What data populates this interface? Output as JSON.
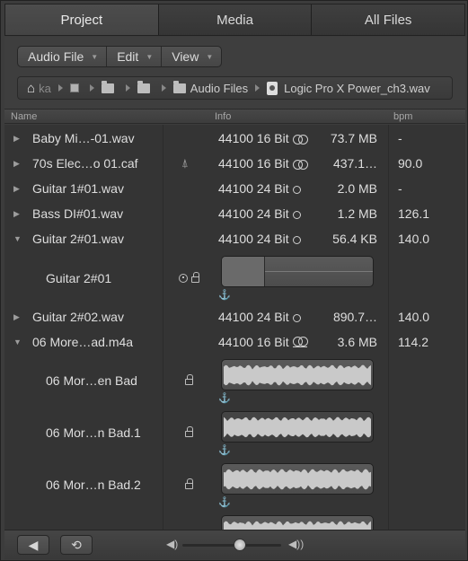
{
  "tabs": [
    "Project",
    "Media",
    "All Files"
  ],
  "toolbar": {
    "menus": [
      "Audio File",
      "Edit",
      "View"
    ]
  },
  "path": {
    "home": "ka",
    "folder": "Audio Files",
    "file": "Logic Pro X Power_ch3.wav"
  },
  "columns": {
    "name": "Name",
    "info": "Info",
    "bpm": "bpm"
  },
  "rows": [
    {
      "name": "Baby Mi…-01.wav",
      "info": "44100 16 Bit",
      "channel": "stereo",
      "size": "73.7 MB",
      "bpm": "-"
    },
    {
      "name": "70s Elec…o 01.caf",
      "info": "44100 16 Bit",
      "channel": "stereo-split",
      "size": "437.1…",
      "bpm": "90.0"
    },
    {
      "name": "Guitar 1#01.wav",
      "info": "44100 24 Bit",
      "channel": "mono",
      "size": "2.0 MB",
      "bpm": "-"
    },
    {
      "name": "Bass DI#01.wav",
      "info": "44100 24 Bit",
      "channel": "mono",
      "size": "1.2 MB",
      "bpm": "126.1"
    },
    {
      "name": "Guitar 2#01.wav",
      "info": "44100 24 Bit",
      "channel": "mono",
      "size": "56.4 KB",
      "bpm": "140.0"
    },
    {
      "name": "Guitar 2#01"
    },
    {
      "name": "Guitar 2#02.wav",
      "info": "44100 24 Bit",
      "channel": "mono",
      "size": "890.7…",
      "bpm": "140.0"
    },
    {
      "name": "06 More…ad.m4a",
      "info": "44100 16 Bit",
      "channel": "stereo-underlined",
      "size": "3.6 MB",
      "bpm": "114.2"
    },
    {
      "name": "06 Mor…en Bad"
    },
    {
      "name": "06 Mor…n Bad.1"
    },
    {
      "name": "06 Mor…n Bad.2"
    }
  ],
  "colors": {
    "background": "#343434",
    "text": "#dedede",
    "region": "#5a5a5a",
    "waveform": "#c9c9c9"
  },
  "icons": [
    "home-icon",
    "folder-icon",
    "audio-file-icon",
    "metronome-icon",
    "lock-icon",
    "clock-icon",
    "anchor-icon",
    "speaker-icon",
    "loop-icon",
    "volume-low-icon",
    "volume-high-icon"
  ]
}
